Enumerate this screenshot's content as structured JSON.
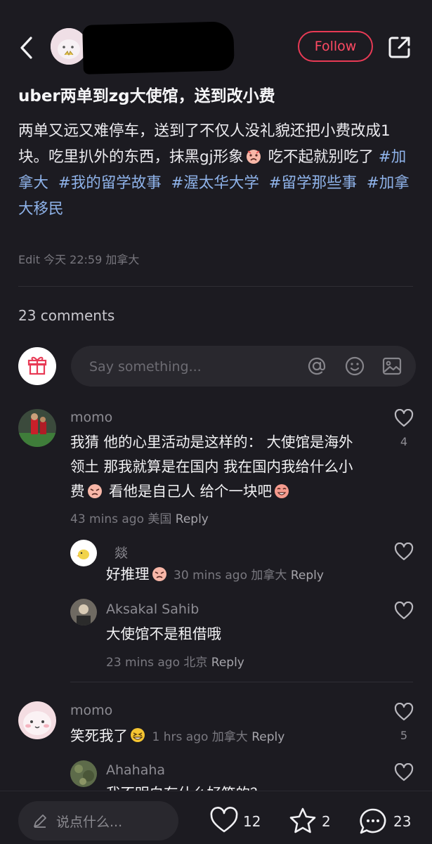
{
  "header": {
    "follow_label": "Follow"
  },
  "post": {
    "title": "uber两单到zg大使馆，送到改小费",
    "body_text": "两单又远又难停车，送到了不仅人没礼貌还把小费改成1块。吃里扒外的东西，抹黑gj形象",
    "body_text_2": " 吃不起就别吃了 ",
    "tags": [
      "#加拿大",
      "#我的留学故事",
      "#渥太华大学",
      "#留学那些事",
      "#加拿大移民"
    ],
    "meta": "Edit 今天 22:59 加拿大"
  },
  "comments_header": "23 comments",
  "comment_input": {
    "placeholder": "Say something..."
  },
  "comments": [
    {
      "name": "momo",
      "text_1": "我猜 他的心里活动是这样的： 大使馆是海外领土 那我就算是在国内 我在国内我给什么小费",
      "text_2": " 看他是自己人 给个一块吧",
      "meta": "43 mins ago 美国",
      "reply_label": "Reply",
      "likes": "4",
      "replies": [
        {
          "name": "燚",
          "text": "好推理",
          "meta": "30 mins ago 加拿大",
          "reply_label": "Reply"
        },
        {
          "name": "Aksakal Sahib",
          "text": "大使馆不是租借哦",
          "meta": "23 mins ago 北京",
          "reply_label": "Reply"
        }
      ]
    },
    {
      "name": "momo",
      "text": "笑死我了",
      "meta": "1 hrs ago 加拿大",
      "reply_label": "Reply",
      "likes": "5",
      "replies": [
        {
          "name": "Ahahaha",
          "text": "我不明白有什么好笑的？"
        }
      ]
    }
  ],
  "bottom_bar": {
    "input_placeholder": "说点什么...",
    "likes": "12",
    "collects": "2",
    "comments": "23"
  },
  "colors": {
    "background": "#1c1b21",
    "accent": "#e83a55",
    "tag": "#8fb3ea"
  }
}
